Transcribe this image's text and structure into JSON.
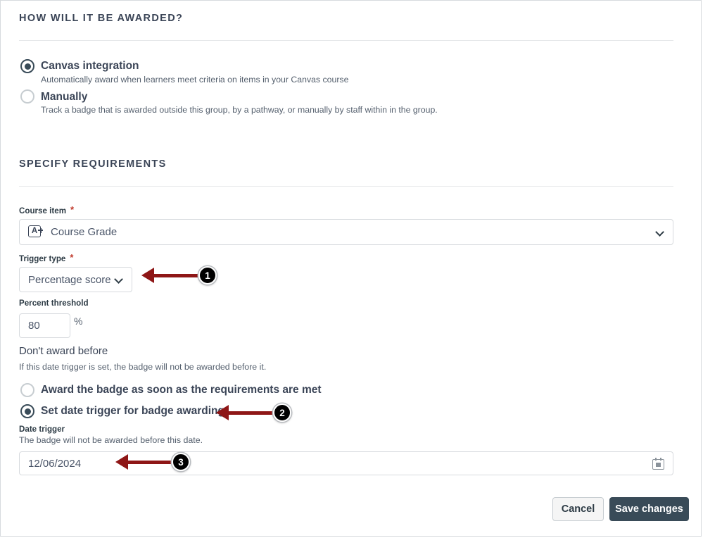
{
  "sections": {
    "awarded": {
      "heading": "HOW WILL IT BE AWARDED?",
      "options": [
        {
          "label": "Canvas integration",
          "description": "Automatically award when learners meet criteria on items in your Canvas course",
          "selected": true
        },
        {
          "label": "Manually",
          "description": "Track a badge that is awarded outside this group, by a pathway, or manually by staff within in the group.",
          "selected": false
        }
      ]
    },
    "requirements": {
      "heading": "SPECIFY REQUIREMENTS",
      "course_item": {
        "label": "Course item",
        "required_marker": "*",
        "value": "Course Grade",
        "icon": "grade-a-plus-icon",
        "dropdown_icon": "chevron-down-icon"
      },
      "trigger_type": {
        "label": "Trigger type",
        "required_marker": "*",
        "value": "Percentage score",
        "dropdown_icon": "chevron-down-icon"
      },
      "percent_threshold": {
        "label": "Percent threshold",
        "value": "80",
        "suffix": "%"
      },
      "dont_award_before": {
        "heading": "Don't award before",
        "help": "If this date trigger is set, the badge will not be awarded before it.",
        "options": [
          {
            "label": "Award the badge as soon as the requirements are met",
            "selected": false
          },
          {
            "label": "Set date trigger for badge awarding",
            "selected": true
          }
        ]
      },
      "date_trigger": {
        "label": "Date trigger",
        "help": "The badge will not be awarded before this date.",
        "value": "12/06/2024",
        "icon": "calendar-icon"
      }
    }
  },
  "footer": {
    "cancel_label": "Cancel",
    "save_label": "Save changes"
  },
  "annotations": [
    {
      "number": "1"
    },
    {
      "number": "2"
    },
    {
      "number": "3"
    }
  ],
  "colors": {
    "accent_dark": "#394b58",
    "annotation_red": "#8e1616",
    "required_red": "#c0392b",
    "border": "#d7dade"
  }
}
